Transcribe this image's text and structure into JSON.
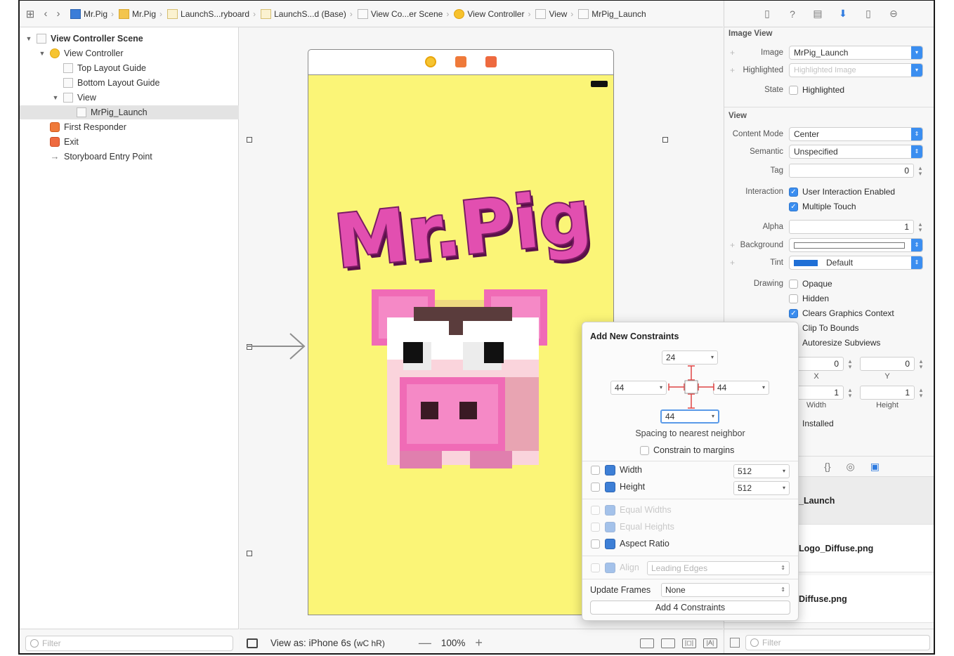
{
  "breadcrumb": [
    {
      "label": "Mr.Pig",
      "icon": "blue"
    },
    {
      "label": "Mr.Pig",
      "icon": "folder"
    },
    {
      "label": "LaunchS...ryboard",
      "icon": "doc"
    },
    {
      "label": "LaunchS...d (Base)",
      "icon": "doc"
    },
    {
      "label": "View Co...er Scene",
      "icon": "scene"
    },
    {
      "label": "View Controller",
      "icon": "yellow"
    },
    {
      "label": "View",
      "icon": "view"
    },
    {
      "label": "MrPig_Launch",
      "icon": "view"
    }
  ],
  "outline": {
    "items": [
      {
        "label": "View Controller Scene",
        "indent": 0,
        "disclosure": "▼",
        "icon": "scene",
        "bold": true
      },
      {
        "label": "View Controller",
        "indent": 1,
        "disclosure": "▼",
        "icon": "vc"
      },
      {
        "label": "Top Layout Guide",
        "indent": 2,
        "disclosure": "",
        "icon": "box"
      },
      {
        "label": "Bottom Layout Guide",
        "indent": 2,
        "disclosure": "",
        "icon": "box"
      },
      {
        "label": "View",
        "indent": 2,
        "disclosure": "▼",
        "icon": "box"
      },
      {
        "label": "MrPig_Launch",
        "indent": 3,
        "disclosure": "",
        "icon": "box",
        "selected": true
      },
      {
        "label": "First Responder",
        "indent": 1,
        "disclosure": "",
        "icon": "fr"
      },
      {
        "label": "Exit",
        "indent": 1,
        "disclosure": "",
        "icon": "ex"
      },
      {
        "label": "Storyboard Entry Point",
        "indent": 1,
        "disclosure": "",
        "icon": "arrow"
      }
    ],
    "filter_placeholder": "Filter"
  },
  "canvas": {
    "title_text": "Mr.Pig",
    "view_as": "View as: iPhone 6s (",
    "view_as_suffix": "wC hR)",
    "zoom": "100%",
    "zoom_minus": "—",
    "zoom_plus": "+"
  },
  "inspector": {
    "image_view": {
      "section": "Image View",
      "image_label": "Image",
      "image_value": "MrPig_Launch",
      "highlighted_label": "Highlighted",
      "highlighted_placeholder": "Highlighted Image",
      "state_label": "State",
      "state_value": "Highlighted"
    },
    "view": {
      "section": "View",
      "content_mode_label": "Content Mode",
      "content_mode": "Center",
      "semantic_label": "Semantic",
      "semantic": "Unspecified",
      "tag_label": "Tag",
      "tag": "0",
      "interaction_label": "Interaction",
      "user_interaction": "User Interaction Enabled",
      "multiple_touch": "Multiple Touch",
      "alpha_label": "Alpha",
      "alpha": "1",
      "background_label": "Background",
      "tint_label": "Tint",
      "tint": "Default",
      "drawing_label": "Drawing",
      "opaque": "Opaque",
      "hidden": "Hidden",
      "clears": "Clears Graphics Context",
      "clip": "Clip To Bounds",
      "autoresize": "Autoresize Subviews",
      "x": "0",
      "y": "0",
      "x_label": "X",
      "y_label": "Y",
      "width": "1",
      "height": "1",
      "width_label": "Width",
      "height_label": "Height",
      "installed": "Installed"
    },
    "library_items": [
      "_Launch",
      "Logo_Diffuse.png",
      "Diffuse.png"
    ],
    "filter_placeholder": "Filter"
  },
  "constraints": {
    "title": "Add New Constraints",
    "top": "24",
    "left": "44",
    "right": "44",
    "bottom": "44",
    "spacing_caption": "Spacing to nearest neighbor",
    "constrain_margins": "Constrain to margins",
    "width_label": "Width",
    "width_value": "512",
    "height_label": "Height",
    "height_value": "512",
    "equal_widths": "Equal Widths",
    "equal_heights": "Equal Heights",
    "aspect_ratio": "Aspect Ratio",
    "align_label": "Align",
    "align_value": "Leading Edges",
    "update_frames_label": "Update Frames",
    "update_frames_value": "None",
    "add_button": "Add 4 Constraints"
  },
  "colors": {
    "accent": "#3b8ef0",
    "screen_bg": "#fbf577",
    "pig_pink": "#f06bb6"
  }
}
